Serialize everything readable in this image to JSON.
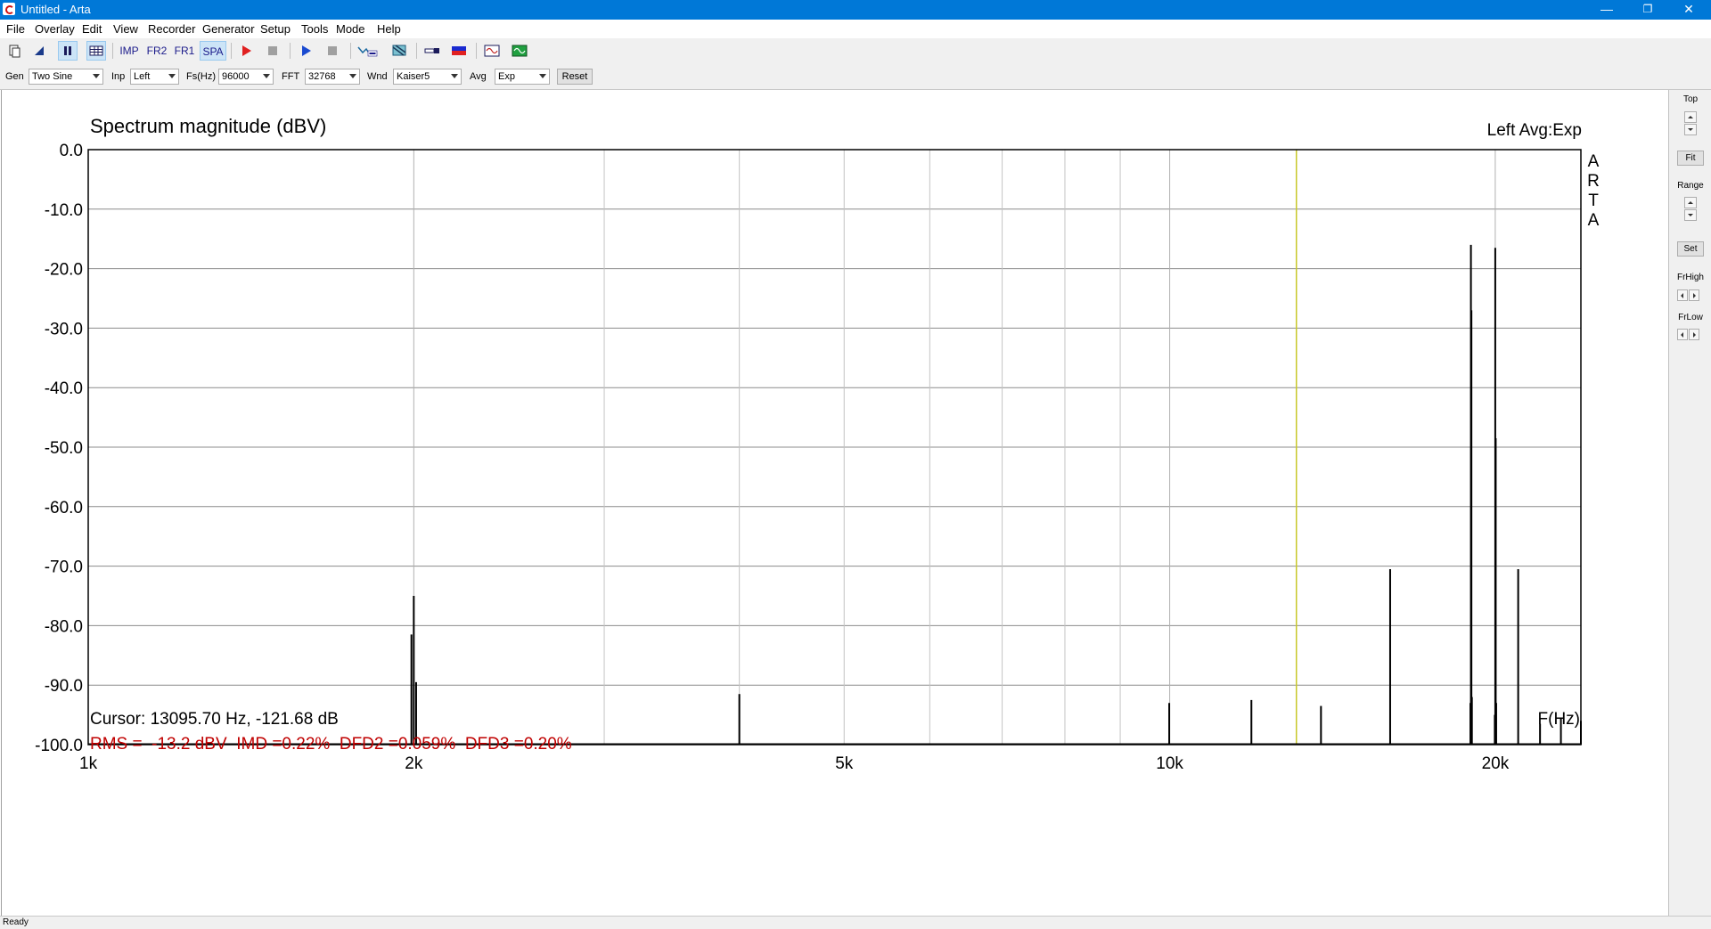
{
  "window": {
    "title": "Untitled - Arta",
    "minimize": "—",
    "restore": "❐",
    "close": "✕"
  },
  "menu": [
    "File",
    "Overlay",
    "Edit",
    "View",
    "Recorder",
    "Generator",
    "Setup",
    "Tools",
    "Mode",
    "Help"
  ],
  "toolbar": {
    "imp": "IMP",
    "fr2": "FR2",
    "fr1": "FR1",
    "spa": "SPA",
    "icons": [
      "new-file-icon",
      "open-icon",
      "pause-icon",
      "table-icon",
      "record-icon",
      "stop-icon",
      "play-icon",
      "stop-icon",
      "abc-icon",
      "filter-icon",
      "connector-icon",
      "flag-icon",
      "scope-icon",
      "generator-icon"
    ]
  },
  "controls": {
    "gen_label": "Gen",
    "gen_value": "Two Sine",
    "inp_label": "Inp",
    "inp_value": "Left",
    "fs_label": "Fs(Hz)",
    "fs_value": "96000",
    "fft_label": "FFT",
    "fft_value": "32768",
    "wnd_label": "Wnd",
    "wnd_value": "Kaiser5",
    "avg_label": "Avg",
    "avg_value": "Exp",
    "reset_label": "Reset"
  },
  "right_panel": {
    "top_label": "Top",
    "fit_label": "Fit",
    "range_label": "Range",
    "set_label": "Set",
    "frhigh_label": "FrHigh",
    "frlow_label": "FrLow"
  },
  "graph": {
    "cursor_text": "Cursor: 13095.70 Hz, -121.68 dB",
    "stats_text": "RMS =  -13.2 dBV  IMD =0.22%  DFD2 =0.059%  DFD3 =0.20%",
    "watermark": [
      "A",
      "R",
      "T",
      "A"
    ],
    "colors": {
      "cursor_line": "#c8c828",
      "stats_text": "#c00000",
      "grid": "#8c8c8c",
      "trace": "#000000"
    }
  },
  "chart_data": {
    "type": "line",
    "title": "Spectrum magnitude (dBV)",
    "legend_text": "Left  Avg:Exp",
    "xlabel": "F(Hz)",
    "ylabel": "",
    "x_scale": "log",
    "xlim": [
      1000,
      24000
    ],
    "ylim": [
      -100,
      0
    ],
    "x_tick_labels": [
      {
        "value": 1000,
        "label": "1k"
      },
      {
        "value": 2000,
        "label": "2k"
      },
      {
        "value": 5000,
        "label": "5k"
      },
      {
        "value": 10000,
        "label": "10k"
      },
      {
        "value": 20000,
        "label": "20k"
      }
    ],
    "y_tick_labels": [
      "0.0",
      "-10.0",
      "-20.0",
      "-30.0",
      "-40.0",
      "-50.0",
      "-60.0",
      "-70.0",
      "-80.0",
      "-90.0",
      "-100.0"
    ],
    "grid": true,
    "cursor_x": 13096,
    "series": [
      {
        "peaks": [
          {
            "f": 1990,
            "db": -81.5
          },
          {
            "f": 2000,
            "db": -75
          },
          {
            "f": 2010,
            "db": -89.5
          },
          {
            "f": 4000,
            "db": -91.5
          },
          {
            "f": 9990,
            "db": -93
          },
          {
            "f": 11900,
            "db": -92.5
          },
          {
            "f": 13800,
            "db": -93.5
          },
          {
            "f": 15990,
            "db": -70.5
          },
          {
            "f": 18970,
            "db": -93
          },
          {
            "f": 18990,
            "db": -16
          },
          {
            "f": 19010,
            "db": -27
          },
          {
            "f": 19030,
            "db": -92
          },
          {
            "f": 19980,
            "db": -95
          },
          {
            "f": 20000,
            "db": -16.5
          },
          {
            "f": 20020,
            "db": -48.5
          },
          {
            "f": 20040,
            "db": -93
          },
          {
            "f": 21000,
            "db": -70.5
          },
          {
            "f": 22000,
            "db": -96.5
          },
          {
            "f": 23000,
            "db": -95.5
          },
          {
            "f": 24000,
            "db": -96
          }
        ]
      }
    ]
  }
}
